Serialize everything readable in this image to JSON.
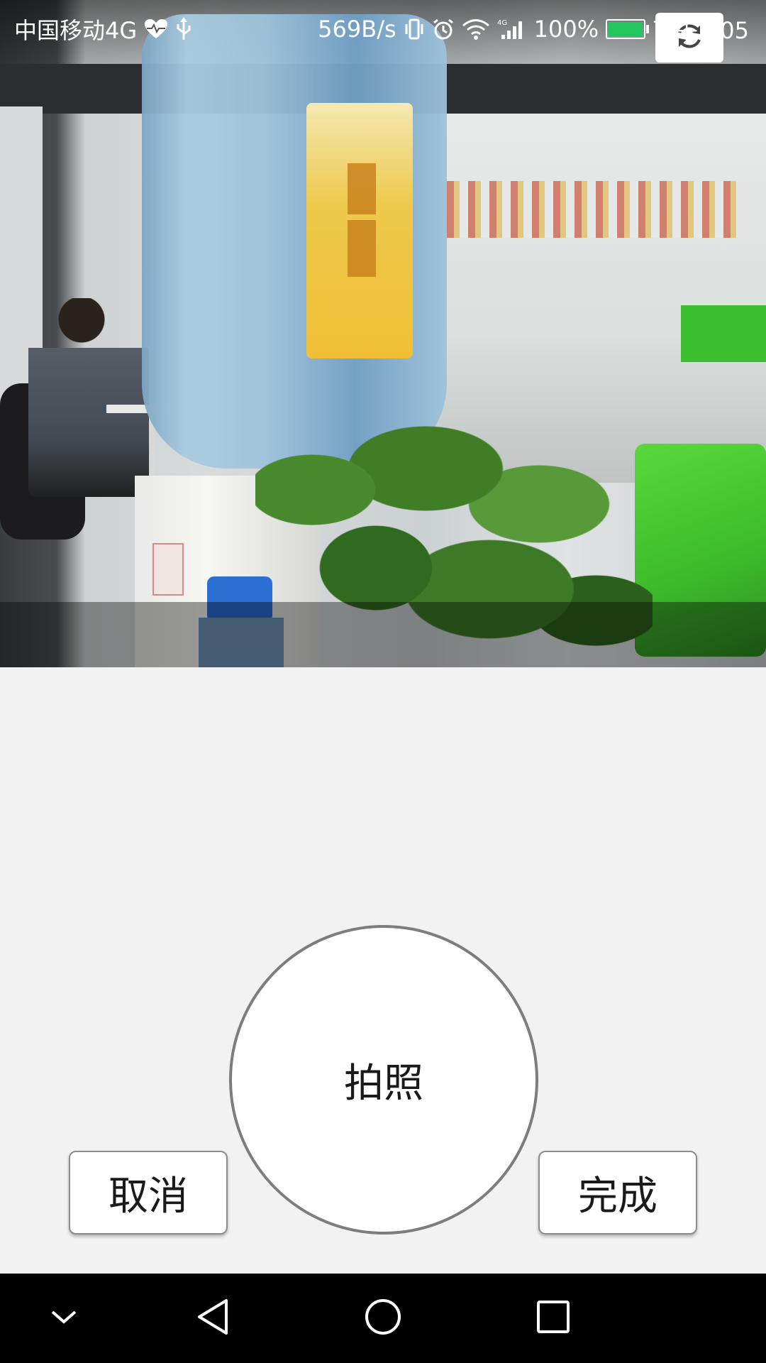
{
  "status_bar": {
    "carrier": "中国移动4G",
    "net_speed": "569B/s",
    "battery": "100%",
    "time": "下午2:05",
    "icons": [
      "heart-rate-icon",
      "usb-icon",
      "vibrate-icon",
      "alarm-icon",
      "wifi-icon",
      "4g-signal-icon",
      "battery-icon"
    ]
  },
  "camera": {
    "switch_icon": "camera-switch-icon"
  },
  "actions": {
    "shutter_label": "拍照",
    "cancel_label": "取消",
    "done_label": "完成"
  },
  "nav_bar": {
    "icons": [
      "collapse-chevron-icon",
      "back-icon",
      "home-icon",
      "recents-icon"
    ]
  }
}
